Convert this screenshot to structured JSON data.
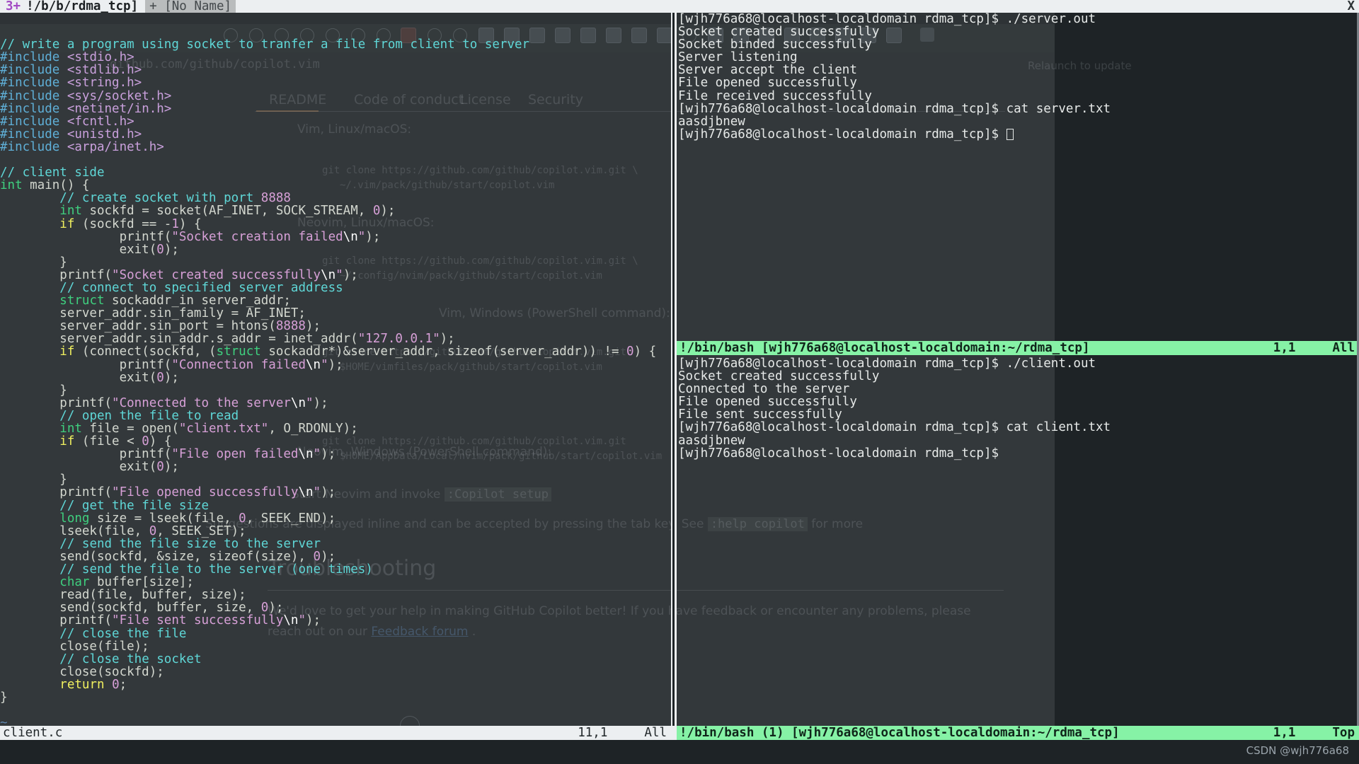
{
  "window": {
    "title": "vim — client.c — tmux split with bash",
    "close_glyph": "X"
  },
  "tabline": {
    "active_index_label": "3+",
    "active_path": "!/b/b/rdma_tcp]",
    "inactive_tab": "+ [No Name]"
  },
  "editor": {
    "filename": "client.c",
    "cursor_position": "11,1",
    "scroll_position": "All",
    "empty_line_marker": "~",
    "lines": [
      [
        {
          "t": "// write a program using socket to tranfer a file from client to server",
          "c": "c-comment"
        }
      ],
      [
        {
          "t": "#include",
          "c": "c-pre"
        },
        {
          "t": " ",
          "c": "c-plain"
        },
        {
          "t": "<stdio.h>",
          "c": "c-inc"
        }
      ],
      [
        {
          "t": "#include",
          "c": "c-pre"
        },
        {
          "t": " ",
          "c": "c-plain"
        },
        {
          "t": "<stdlib.h>",
          "c": "c-inc"
        }
      ],
      [
        {
          "t": "#include",
          "c": "c-pre"
        },
        {
          "t": " ",
          "c": "c-plain"
        },
        {
          "t": "<string.h>",
          "c": "c-inc"
        }
      ],
      [
        {
          "t": "#include",
          "c": "c-pre"
        },
        {
          "t": " ",
          "c": "c-plain"
        },
        {
          "t": "<sys/socket.h>",
          "c": "c-inc"
        }
      ],
      [
        {
          "t": "#include",
          "c": "c-pre"
        },
        {
          "t": " ",
          "c": "c-plain"
        },
        {
          "t": "<netinet/in.h>",
          "c": "c-inc"
        }
      ],
      [
        {
          "t": "#include",
          "c": "c-pre"
        },
        {
          "t": " ",
          "c": "c-plain"
        },
        {
          "t": "<fcntl.h>",
          "c": "c-inc"
        }
      ],
      [
        {
          "t": "#include",
          "c": "c-pre"
        },
        {
          "t": " ",
          "c": "c-plain"
        },
        {
          "t": "<unistd.h>",
          "c": "c-inc"
        }
      ],
      [
        {
          "t": "#include",
          "c": "c-pre"
        },
        {
          "t": " ",
          "c": "c-plain"
        },
        {
          "t": "<arpa/inet.h>",
          "c": "c-inc"
        }
      ],
      [],
      [
        {
          "t": "// client side",
          "c": "c-comment"
        }
      ],
      [
        {
          "t": "int",
          "c": "c-type"
        },
        {
          "t": " main() {",
          "c": "c-plain"
        }
      ],
      [
        {
          "t": "        ",
          "c": "c-plain"
        },
        {
          "t": "// create socket with port ",
          "c": "c-comment"
        },
        {
          "t": "8888",
          "c": "c-num"
        }
      ],
      [
        {
          "t": "        ",
          "c": "c-plain"
        },
        {
          "t": "int",
          "c": "c-type"
        },
        {
          "t": " sockfd = socket(AF_INET, SOCK_STREAM, ",
          "c": "c-plain"
        },
        {
          "t": "0",
          "c": "c-num"
        },
        {
          "t": ");",
          "c": "c-plain"
        }
      ],
      [
        {
          "t": "        ",
          "c": "c-plain"
        },
        {
          "t": "if",
          "c": "c-kw"
        },
        {
          "t": " (sockfd == -",
          "c": "c-plain"
        },
        {
          "t": "1",
          "c": "c-num"
        },
        {
          "t": ") {",
          "c": "c-plain"
        }
      ],
      [
        {
          "t": "                printf(",
          "c": "c-plain"
        },
        {
          "t": "\"Socket creation failed",
          "c": "c-str"
        },
        {
          "t": "\\n",
          "c": "c-esc"
        },
        {
          "t": "\"",
          "c": "c-str"
        },
        {
          "t": ");",
          "c": "c-plain"
        }
      ],
      [
        {
          "t": "                exit(",
          "c": "c-plain"
        },
        {
          "t": "0",
          "c": "c-num"
        },
        {
          "t": ");",
          "c": "c-plain"
        }
      ],
      [
        {
          "t": "        }",
          "c": "c-plain"
        }
      ],
      [
        {
          "t": "        printf(",
          "c": "c-plain"
        },
        {
          "t": "\"Socket created successfully",
          "c": "c-str"
        },
        {
          "t": "\\n",
          "c": "c-esc"
        },
        {
          "t": "\"",
          "c": "c-str"
        },
        {
          "t": ");",
          "c": "c-plain"
        }
      ],
      [
        {
          "t": "        ",
          "c": "c-plain"
        },
        {
          "t": "// connect to specified server address",
          "c": "c-comment"
        }
      ],
      [
        {
          "t": "        ",
          "c": "c-plain"
        },
        {
          "t": "struct",
          "c": "c-type"
        },
        {
          "t": " sockaddr_in server_addr;",
          "c": "c-plain"
        }
      ],
      [
        {
          "t": "        server_addr.sin_family = AF_INET;",
          "c": "c-plain"
        }
      ],
      [
        {
          "t": "        server_addr.sin_port = htons(",
          "c": "c-plain"
        },
        {
          "t": "8888",
          "c": "c-num"
        },
        {
          "t": ");",
          "c": "c-plain"
        }
      ],
      [
        {
          "t": "        server_addr.sin_addr.s_addr = inet_addr(",
          "c": "c-plain"
        },
        {
          "t": "\"127.0.0.1\"",
          "c": "c-str"
        },
        {
          "t": ");",
          "c": "c-plain"
        }
      ],
      [
        {
          "t": "        ",
          "c": "c-plain"
        },
        {
          "t": "if",
          "c": "c-kw"
        },
        {
          "t": " (connect(sockfd, (",
          "c": "c-plain"
        },
        {
          "t": "struct",
          "c": "c-type"
        },
        {
          "t": " sockaddr*)&server_addr, sizeof(server_addr)) != ",
          "c": "c-plain"
        },
        {
          "t": "0",
          "c": "c-num"
        },
        {
          "t": ") {",
          "c": "c-plain"
        }
      ],
      [
        {
          "t": "                printf(",
          "c": "c-plain"
        },
        {
          "t": "\"Connection failed",
          "c": "c-str"
        },
        {
          "t": "\\n",
          "c": "c-esc"
        },
        {
          "t": "\"",
          "c": "c-str"
        },
        {
          "t": ");",
          "c": "c-plain"
        }
      ],
      [
        {
          "t": "                exit(",
          "c": "c-plain"
        },
        {
          "t": "0",
          "c": "c-num"
        },
        {
          "t": ");",
          "c": "c-plain"
        }
      ],
      [
        {
          "t": "        }",
          "c": "c-plain"
        }
      ],
      [
        {
          "t": "        printf(",
          "c": "c-plain"
        },
        {
          "t": "\"Connected to the server",
          "c": "c-str"
        },
        {
          "t": "\\n",
          "c": "c-esc"
        },
        {
          "t": "\"",
          "c": "c-str"
        },
        {
          "t": ");",
          "c": "c-plain"
        }
      ],
      [
        {
          "t": "        ",
          "c": "c-plain"
        },
        {
          "t": "// open the file to read",
          "c": "c-comment"
        }
      ],
      [
        {
          "t": "        ",
          "c": "c-plain"
        },
        {
          "t": "int",
          "c": "c-type"
        },
        {
          "t": " file = open(",
          "c": "c-plain"
        },
        {
          "t": "\"client.txt\"",
          "c": "c-str"
        },
        {
          "t": ", O_RDONLY);",
          "c": "c-plain"
        }
      ],
      [
        {
          "t": "        ",
          "c": "c-plain"
        },
        {
          "t": "if",
          "c": "c-kw"
        },
        {
          "t": " (file < ",
          "c": "c-plain"
        },
        {
          "t": "0",
          "c": "c-num"
        },
        {
          "t": ") {",
          "c": "c-plain"
        }
      ],
      [
        {
          "t": "                printf(",
          "c": "c-plain"
        },
        {
          "t": "\"File open failed",
          "c": "c-str"
        },
        {
          "t": "\\n",
          "c": "c-esc"
        },
        {
          "t": "\"",
          "c": "c-str"
        },
        {
          "t": ");",
          "c": "c-plain"
        }
      ],
      [
        {
          "t": "                exit(",
          "c": "c-plain"
        },
        {
          "t": "0",
          "c": "c-num"
        },
        {
          "t": ");",
          "c": "c-plain"
        }
      ],
      [
        {
          "t": "        }",
          "c": "c-plain"
        }
      ],
      [
        {
          "t": "        printf(",
          "c": "c-plain"
        },
        {
          "t": "\"File opened successfully",
          "c": "c-str"
        },
        {
          "t": "\\n",
          "c": "c-esc"
        },
        {
          "t": "\"",
          "c": "c-str"
        },
        {
          "t": ");",
          "c": "c-plain"
        }
      ],
      [
        {
          "t": "        ",
          "c": "c-plain"
        },
        {
          "t": "// get the file size",
          "c": "c-comment"
        }
      ],
      [
        {
          "t": "        ",
          "c": "c-plain"
        },
        {
          "t": "long",
          "c": "c-type"
        },
        {
          "t": " size = lseek(file, ",
          "c": "c-plain"
        },
        {
          "t": "0",
          "c": "c-num"
        },
        {
          "t": ", SEEK_END);",
          "c": "c-plain"
        }
      ],
      [
        {
          "t": "        lseek(file, ",
          "c": "c-plain"
        },
        {
          "t": "0",
          "c": "c-num"
        },
        {
          "t": ", SEEK_SET);",
          "c": "c-plain"
        }
      ],
      [
        {
          "t": "        ",
          "c": "c-plain"
        },
        {
          "t": "// send the file size to the server",
          "c": "c-comment"
        }
      ],
      [
        {
          "t": "        send(sockfd, &size, sizeof(size), ",
          "c": "c-plain"
        },
        {
          "t": "0",
          "c": "c-num"
        },
        {
          "t": ");",
          "c": "c-plain"
        }
      ],
      [
        {
          "t": "        ",
          "c": "c-plain"
        },
        {
          "t": "// send the file to the server (one times)",
          "c": "c-comment"
        }
      ],
      [
        {
          "t": "        ",
          "c": "c-plain"
        },
        {
          "t": "char",
          "c": "c-type"
        },
        {
          "t": " buffer[size];",
          "c": "c-plain"
        }
      ],
      [
        {
          "t": "        read(file, buffer, size);",
          "c": "c-plain"
        }
      ],
      [
        {
          "t": "        send(sockfd, buffer, size, ",
          "c": "c-plain"
        },
        {
          "t": "0",
          "c": "c-num"
        },
        {
          "t": ");",
          "c": "c-plain"
        }
      ],
      [
        {
          "t": "        printf(",
          "c": "c-plain"
        },
        {
          "t": "\"File sent successfully",
          "c": "c-str"
        },
        {
          "t": "\\n",
          "c": "c-esc"
        },
        {
          "t": "\"",
          "c": "c-str"
        },
        {
          "t": ");",
          "c": "c-plain"
        }
      ],
      [
        {
          "t": "        ",
          "c": "c-plain"
        },
        {
          "t": "// close the file",
          "c": "c-comment"
        }
      ],
      [
        {
          "t": "        close(file);",
          "c": "c-plain"
        }
      ],
      [
        {
          "t": "        ",
          "c": "c-plain"
        },
        {
          "t": "// close the socket",
          "c": "c-comment"
        }
      ],
      [
        {
          "t": "        close(sockfd);",
          "c": "c-plain"
        }
      ],
      [
        {
          "t": "        ",
          "c": "c-plain"
        },
        {
          "t": "return",
          "c": "c-kw"
        },
        {
          "t": " ",
          "c": "c-plain"
        },
        {
          "t": "0",
          "c": "c-num"
        },
        {
          "t": ";",
          "c": "c-plain"
        }
      ],
      [
        {
          "t": "}",
          "c": "c-plain"
        }
      ],
      [],
      [
        {
          "t": "~",
          "c": "tilde"
        }
      ],
      [
        {
          "t": "~",
          "c": "tilde"
        }
      ]
    ]
  },
  "terminal_top": {
    "title": "!/bin/bash [wjh776a68@localhost-localdomain:~/rdma_tcp]",
    "cursor_position": "1,1",
    "scroll_position": "All",
    "lines": [
      "[wjh776a68@localhost-localdomain rdma_tcp]$ ./server.out",
      "Socket created successfully",
      "Socket binded successfully",
      "Server listening",
      "Server accept the client",
      "File opened successfully",
      "File received successfully",
      "[wjh776a68@localhost-localdomain rdma_tcp]$ cat server.txt",
      "aasdjbnew",
      "[wjh776a68@localhost-localdomain rdma_tcp]$ "
    ],
    "cursor_on_last_line": true
  },
  "terminal_bottom": {
    "title": "!/bin/bash (1) [wjh776a68@localhost-localdomain:~/rdma_tcp]",
    "cursor_position": "1,1",
    "scroll_position": "Top",
    "lines": [
      "[wjh776a68@localhost-localdomain rdma_tcp]$ ./client.out",
      "Socket created successfully",
      "Connected to the server",
      "File opened successfully",
      "File sent successfully",
      "[wjh776a68@localhost-localdomain rdma_tcp]$ cat client.txt",
      "aasdjbnew",
      "[wjh776a68@localhost-localdomain rdma_tcp]$"
    ]
  },
  "ghost_browser": {
    "url_hint": "github.com/github/copilot.vim",
    "nav_tabs": [
      "README",
      "Code of conduct",
      "License",
      "Security"
    ],
    "reload_label": "Relaunch to update",
    "body_lines": [
      "Vim, Linux/macOS:",
      "git clone https://github.com/github/copilot.vim.git \\",
      "  ~/.vim/pack/github/start/copilot.vim",
      "Neovim, Linux/macOS:",
      "git clone https://github.com/github/copilot.vim.git \\",
      "  ~/.config/nvim/pack/github/start/copilot.vim",
      "Vim, Windows (PowerShell command):",
      "git clone https://github.com/github/copilot.vim.git",
      "  $HOME/vimfiles/pack/github/start/copilot.vim",
      "Neovim, Windows (PowerShell command):",
      "git clone https://github.com/github/copilot.vim.git",
      "  $HOME/AppData/Local/nvim/pack/github/start/copilot.vim"
    ],
    "setup_line_pre": "Start Neovim and invoke",
    "setup_code": ":Copilot setup",
    "suggestion_line_pre": "Suggestions are displayed inline and can be accepted by pressing the tab key. See",
    "suggestion_code": ":help copilot",
    "suggestion_line_post": "for more",
    "troubleshooting_heading": "Troubleshooting",
    "troubleshooting_body_1": "We'd love to get your help in making GitHub Copilot better! If you have feedback or encounter any problems, please",
    "troubleshooting_body_2_pre": "reach out on our",
    "troubleshooting_link": "Feedback forum",
    "troubleshooting_body_2_post": "."
  },
  "watermark": {
    "text": "CSDN @wjh776a68"
  }
}
